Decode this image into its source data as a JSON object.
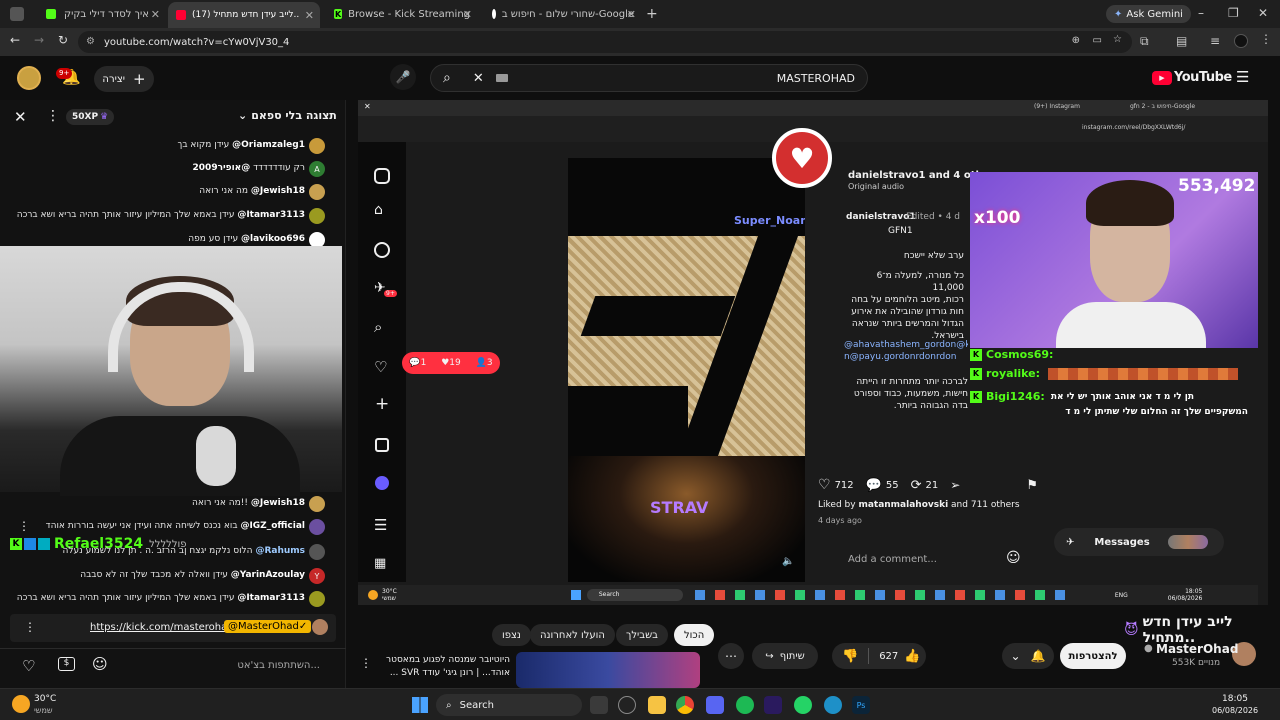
{
  "browser": {
    "tabs": [
      {
        "title": "איך לסדר דילי בקיק",
        "active": false
      },
      {
        "title": "(17) לייב עידן חדש מתחיל..",
        "active": true
      },
      {
        "title": "Browse - Kick Streaming",
        "active": false
      },
      {
        "title": "שחורי שלום - חיפוש ב-Google",
        "active": false
      }
    ],
    "ask_gemini": "Ask Gemini",
    "url": "youtube.com/watch?v=cYw0VjV30_4"
  },
  "youtube": {
    "create_label": "יצירה",
    "notif_count": "9+",
    "search_value": "MASTEROHAD",
    "logo": "YouTube"
  },
  "chat": {
    "header_title": "תצוגה בלי ספאם",
    "xp": "50XP",
    "messages": [
      {
        "user": "@Oriamzaleg1",
        "text": "עידן מקוא בך",
        "color": "#c89a3a"
      },
      {
        "user": "@אופיר2009",
        "text": "רק עודדדדדד",
        "color": "#2e7d32",
        "initial": "A"
      },
      {
        "user": "@Jewish18",
        "text": "מה אני רואה",
        "color": "#c8a050"
      },
      {
        "user": "@Itamar3113",
        "text": "עידן באמא שלך המיליון עיזור אותך תהיה בריא ושא ברכה",
        "color": "#9a9a20"
      },
      {
        "user": "@lavikoo696",
        "text": "עידן סע מפה",
        "color": "#ffffff"
      },
      {
        "user": "@Jewish18",
        "text": "מה אני רואה!!",
        "color": "#c8a050"
      },
      {
        "user": "@IGZ_official",
        "text": "בוא נכנס לשיחה אתה ועידן אני יעשה בוררות אוהד",
        "color": "#6b4fa0"
      },
      {
        "user": "@Rahums",
        "text": "הלוס נלקמ יגצח ןב הרזב .ה . תן לנו לשמוע נעלה",
        "color": "#555"
      },
      {
        "user": "@YarinAzoulay",
        "text": "עידן וואלה לא מכבד שלך זה לא סבבה",
        "color": "#c62828",
        "initial": "Y"
      },
      {
        "user": "@Itamar3113",
        "text": "עידן באמא שלך המיליון עיזור אותך תהיה בריא ושא ברכה",
        "color": "#9a9a20"
      }
    ],
    "overlay_name": "Refael3524",
    "overlay_sub": "פוללללל",
    "pinned_link": "https://kick.com/masterohad",
    "pinned_user": "@MasterOhad✓",
    "input_placeholder": "השתתפות בצ'אט..."
  },
  "instagram": {
    "tab1": "(9+) Instagram",
    "tab2": "gfn 2 - חיפוש ב-Google",
    "url": "instagram.com/reel/DbgXXLWtd6j/",
    "author": "danielstravo1 and 4 others",
    "audio": "Original audio",
    "caption_user": "danielstravo1",
    "caption_meta": "Edited • 4 d",
    "tag": "GFN1",
    "caption_lines": [
      "ערב שלא יישכח",
      "כל מנורה, למעלה מ־6 11,000",
      "רכות, מיטב הלוחמים על בחה",
      "חות גורדון שהובילה את אירוע",
      "הגדול והמרשים ביותר שנראה",
      "בישראל."
    ],
    "mentions": "@ahavathashem_gordon@kids_gordo",
    "mentions2": "n@payu.gordonrdonrdon",
    "caption2": [
      "לברכה יותר מתחרות זו הייתה",
      "חישות, משמעות, כבוד וספורט",
      "בדה הגבוהה ביותר."
    ],
    "likes": "712",
    "comments": "55",
    "shares": "21",
    "liked_by": "Liked by",
    "liked_user": "matanmalahovski",
    "liked_rest": "and 711 others",
    "date": "4 days ago",
    "add_comment": "Add a comment...",
    "messages": "Messages",
    "notif_comments": "1",
    "notif_likes": "19",
    "notif_follows": "3",
    "reel_watermark": "STRAV",
    "super_noam": "Super_Noam",
    "nav_badge": "9+"
  },
  "stream": {
    "viewers": "553,492",
    "multiplier": "x100",
    "chat": [
      {
        "user": "Cosmos69:",
        "text": ""
      },
      {
        "user": "royalike:",
        "text": ""
      },
      {
        "user": "Bigi1246:",
        "text": "תן לי מ ד אני אוהב אותך יש לי את"
      },
      {
        "user": "",
        "text": "המשקפיים שלך זה החלום שלי שתיתן לי מ ד"
      }
    ]
  },
  "inner_taskbar": {
    "search": "Search",
    "weather": "30°C",
    "weather_sub": "שמשי",
    "lang": "ENG",
    "time": "18:05",
    "date": "06/08/2026"
  },
  "video_info": {
    "title": "לייב עידן חדש מתחיל..",
    "channel": "MasterOhad",
    "subs": "553K מנויים",
    "subscribe": "להצטרפות",
    "likes": "627",
    "share": "שיתוף",
    "chips": [
      "הכול",
      "בשבילך",
      "הועלו לאחרונה",
      "נצפו"
    ],
    "rec_title": "היוטיובר שמנסה לפגוע במאסטר אוהד... | רונן גיגי' עודד SVR ..."
  },
  "taskbar": {
    "search": "Search",
    "weather": "30°C",
    "weather_sub": "שמשי",
    "time": "18:05",
    "date": "06/08/2026"
  },
  "colors": {
    "kick_green": "#53fc18",
    "yt_red": "#ff0033",
    "insta_badge": "#ff3040"
  }
}
